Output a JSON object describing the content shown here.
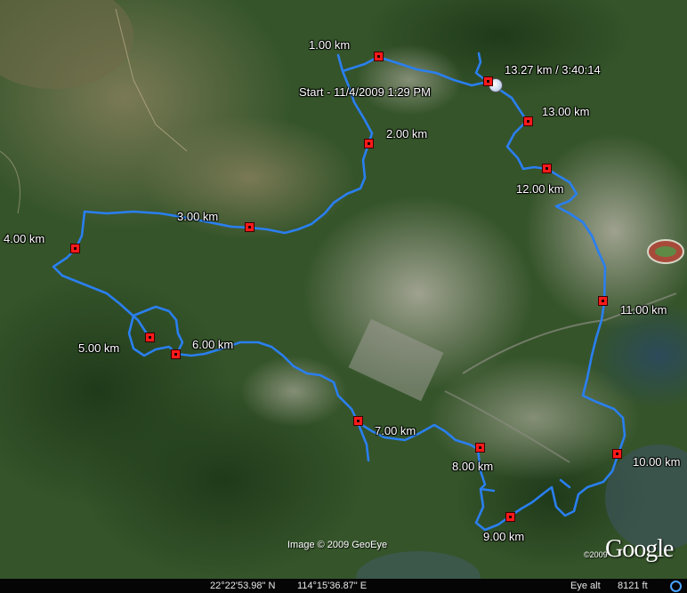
{
  "route_color": "#2a7ff0",
  "marker_color": "#ff1a1a",
  "labels": {
    "km1": "1.00 km",
    "km2": "2.00 km",
    "km3": "3.00 km",
    "km4": "4.00 km",
    "km5": "5.00 km",
    "km6": "6.00 km",
    "km7": "7.00 km",
    "km8": "8.00 km",
    "km9": "9.00 km",
    "km10": "10.00 km",
    "km11": "11.00 km",
    "km12": "12.00 km",
    "km13": "13.00 km",
    "end": "13.27 km / 3:40:14",
    "start": "Start - 11/4/2009 1:29 PM"
  },
  "credit": "Image © 2009 GeoEye",
  "logo": "Google",
  "logo_year": "©2009",
  "status": {
    "latitude": "22°22'53.98\" N",
    "longitude": "114°15'36.87\" E",
    "eye_alt_label": "Eye alt",
    "eye_alt_value": "8121 ft"
  }
}
